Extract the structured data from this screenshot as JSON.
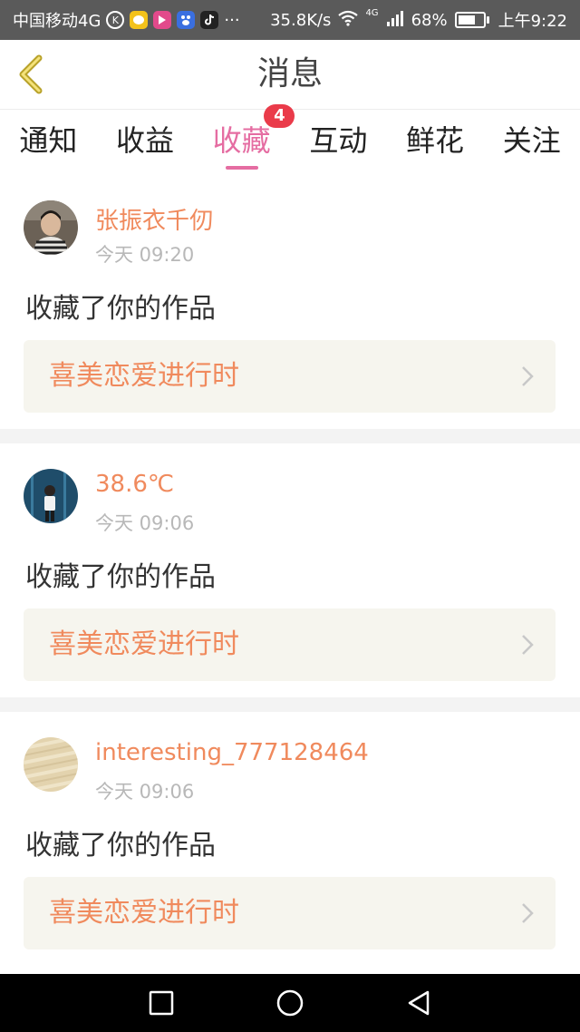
{
  "status_bar": {
    "carrier": "中国移动4G",
    "network_speed": "35.8K/s",
    "network_type": "4G",
    "battery_percent": "68%",
    "battery_level": 0.68,
    "time": "上午9:22",
    "more": "···"
  },
  "header": {
    "title": "消息"
  },
  "tabs": [
    {
      "label": "通知",
      "active": false
    },
    {
      "label": "收益",
      "active": false
    },
    {
      "label": "收藏",
      "active": true,
      "badge": "4"
    },
    {
      "label": "互动",
      "active": false
    },
    {
      "label": "鲜花",
      "active": false
    },
    {
      "label": "关注",
      "active": false
    }
  ],
  "messages": [
    {
      "username": "张振衣千仞",
      "time": "今天 09:20",
      "action": "收藏了你的作品",
      "work_title": "喜美恋爱进行时"
    },
    {
      "username": "38.6℃",
      "time": "今天 09:06",
      "action": "收藏了你的作品",
      "work_title": "喜美恋爱进行时"
    },
    {
      "username": "interesting_777128464",
      "time": "今天 09:06",
      "action": "收藏了你的作品",
      "work_title": "喜美恋爱进行时"
    }
  ],
  "colors": {
    "accent_pink": "#e56da2",
    "username_orange": "#f08a5d",
    "badge_red": "#ea3b4a",
    "work_card_bg": "#f6f5ee"
  },
  "icons": {
    "back": "chevron-left-icon",
    "work_link": "chevron-right-icon",
    "nav_recent": "square-icon",
    "nav_home": "circle-icon",
    "nav_back": "triangle-back-icon"
  }
}
